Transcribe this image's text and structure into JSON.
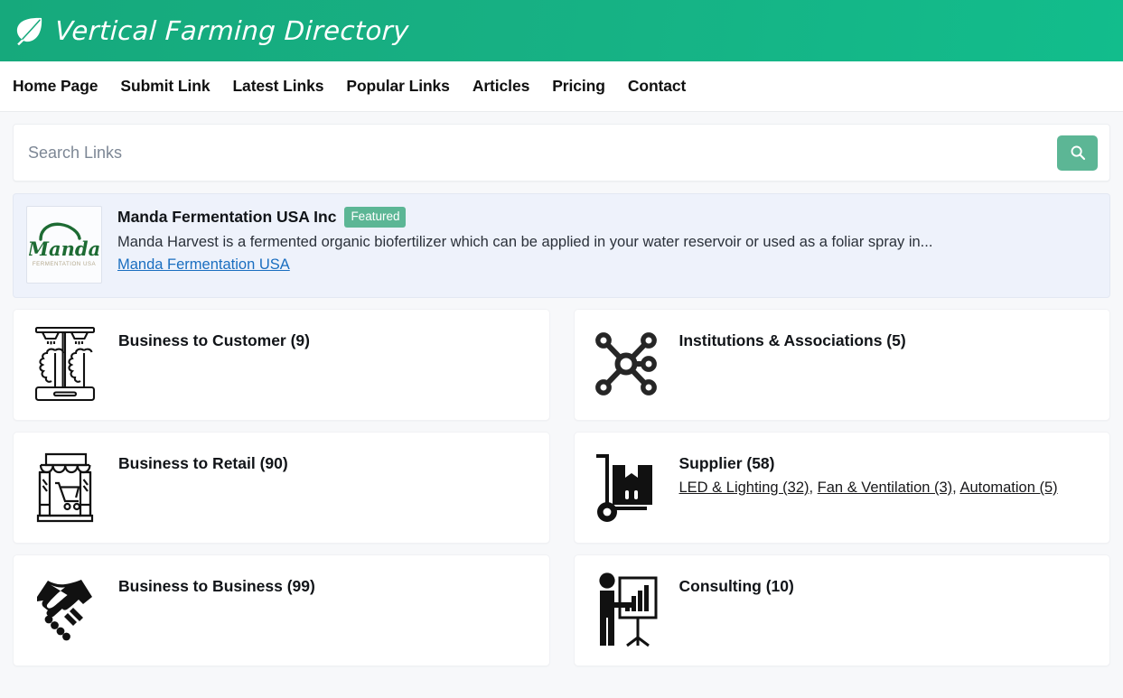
{
  "header": {
    "brand_title": "Vertical Farming Directory",
    "logo_icon": "leaf-icon",
    "gradient_from": "#16a97c",
    "gradient_to": "#12bd8c"
  },
  "nav": {
    "items": [
      {
        "label": "Home Page"
      },
      {
        "label": "Submit Link"
      },
      {
        "label": "Latest Links"
      },
      {
        "label": "Popular Links"
      },
      {
        "label": "Articles"
      },
      {
        "label": "Pricing"
      },
      {
        "label": "Contact"
      }
    ]
  },
  "search": {
    "placeholder": "Search Links",
    "value": "",
    "button_icon": "search-icon",
    "button_color": "#5cb695"
  },
  "featured": {
    "logo_text": "Manda",
    "logo_subtext": "FERMENTATION USA",
    "title": "Manda Fermentation USA Inc",
    "badge": "Featured",
    "badge_color": "#5cb695",
    "description": "Manda Harvest is a fermented organic biofertilizer which can be applied in your water reservoir or used as a foliar spray in...",
    "link_label": "Manda Fermentation USA",
    "link_color": "#1a6ec0",
    "background_color": "#eef2fb"
  },
  "categories": [
    {
      "title": "Business to Customer (9)",
      "name": "Business to Customer",
      "count": 9,
      "icon": "grow-tower-icon",
      "subcategories": []
    },
    {
      "title": "Institutions & Associations (5)",
      "name": "Institutions & Associations",
      "count": 5,
      "icon": "network-hub-icon",
      "subcategories": []
    },
    {
      "title": "Business to Retail (90)",
      "name": "Business to Retail",
      "count": 90,
      "icon": "storefront-cart-icon",
      "subcategories": []
    },
    {
      "title": "Supplier (58)",
      "name": "Supplier",
      "count": 58,
      "icon": "hand-truck-box-icon",
      "subcategories": [
        {
          "label": "LED & Lighting (32)",
          "separator": ", "
        },
        {
          "label": "Fan & Ventilation (3)",
          "separator": ", "
        },
        {
          "label": "Automation (5)",
          "separator": ""
        }
      ]
    },
    {
      "title": "Business to Business (99)",
      "name": "Business to Business",
      "count": 99,
      "icon": "handshake-icon",
      "subcategories": []
    },
    {
      "title": "Consulting (10)",
      "name": "Consulting",
      "count": 10,
      "icon": "presenter-chart-icon",
      "subcategories": []
    }
  ]
}
